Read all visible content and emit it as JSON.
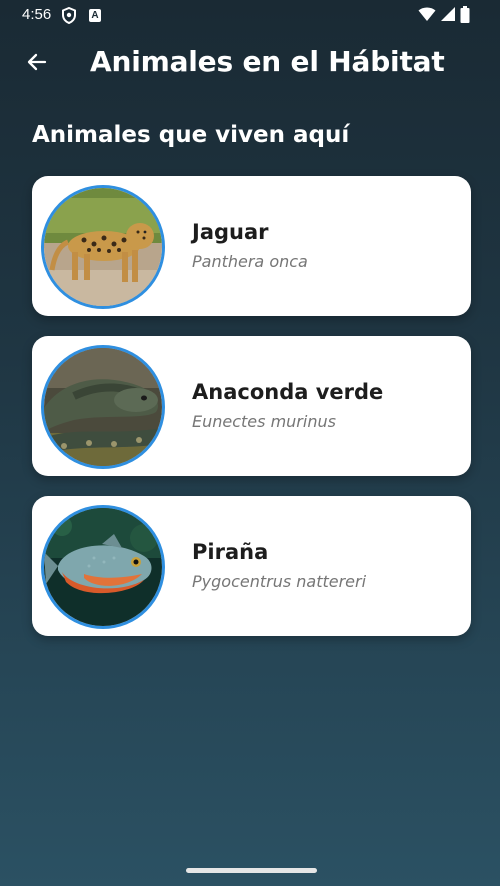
{
  "status_bar": {
    "time": "4:56",
    "icons": [
      "shield-icon",
      "a-notification-icon",
      "wifi-icon",
      "signal-icon",
      "battery-icon"
    ]
  },
  "app_bar": {
    "back_icon": "arrow-left-icon",
    "title": "Animales en el Hábitat"
  },
  "section": {
    "title": "Animales que viven aquí"
  },
  "animals": [
    {
      "name": "Jaguar",
      "scientific_name": "Panthera onca",
      "image": "jaguar-photo"
    },
    {
      "name": "Anaconda verde",
      "scientific_name": "Eunectes murinus",
      "image": "anaconda-photo"
    },
    {
      "name": "Piraña",
      "scientific_name": "Pygocentrus nattereri",
      "image": "piranha-photo"
    }
  ],
  "colors": {
    "background_top": "#1a2a34",
    "background_bottom": "#2b5163",
    "card": "#ffffff",
    "avatar_border": "#2f8fe0",
    "name_text": "#1d1d1d",
    "scientific_text": "#767676"
  }
}
